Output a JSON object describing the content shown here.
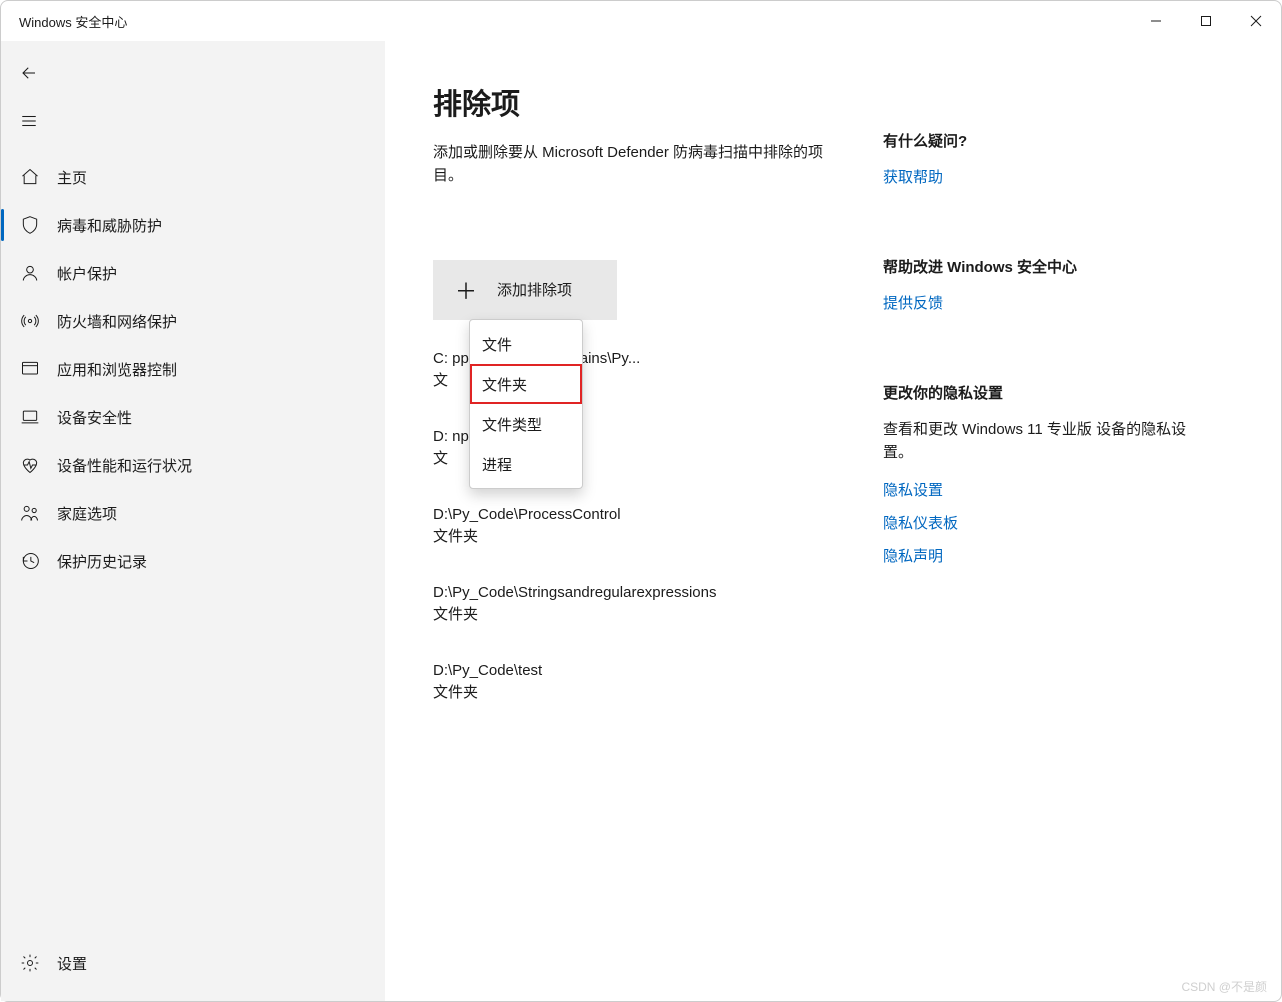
{
  "window": {
    "title": "Windows 安全中心"
  },
  "sidebar": {
    "items": [
      {
        "label": "主页"
      },
      {
        "label": "病毒和威胁防护"
      },
      {
        "label": "帐户保护"
      },
      {
        "label": "防火墙和网络保护"
      },
      {
        "label": "应用和浏览器控制"
      },
      {
        "label": "设备安全性"
      },
      {
        "label": "设备性能和运行状况"
      },
      {
        "label": "家庭选项"
      },
      {
        "label": "保护历史记录"
      }
    ],
    "settings": "设置"
  },
  "page": {
    "title": "排除项",
    "description": "添加或删除要从 Microsoft Defender 防病毒扫描中排除的项目。",
    "add_button": "添加排除项"
  },
  "context_menu": {
    "items": [
      {
        "label": "文件"
      },
      {
        "label": "文件夹"
      },
      {
        "label": "文件类型"
      },
      {
        "label": "进程"
      }
    ]
  },
  "exclusions": [
    {
      "path": "C:                  ppData\\Local\\JetBrains\\Py...",
      "type": "文"
    },
    {
      "path": "D:                  npositeDatatype",
      "type": "文"
    },
    {
      "path": "D:\\Py_Code\\ProcessControl",
      "type": "文件夹"
    },
    {
      "path": "D:\\Py_Code\\Stringsandregularexpressions",
      "type": "文件夹"
    },
    {
      "path": "D:\\Py_Code\\test",
      "type": "文件夹"
    }
  ],
  "rail": {
    "help": {
      "title": "有什么疑问?",
      "link": "获取帮助"
    },
    "improve": {
      "title": "帮助改进 Windows 安全中心",
      "link": "提供反馈"
    },
    "privacy": {
      "title": "更改你的隐私设置",
      "text": "查看和更改 Windows 11 专业版 设备的隐私设置。",
      "links": [
        "隐私设置",
        "隐私仪表板",
        "隐私声明"
      ]
    }
  },
  "watermark": "CSDN @不是颜"
}
